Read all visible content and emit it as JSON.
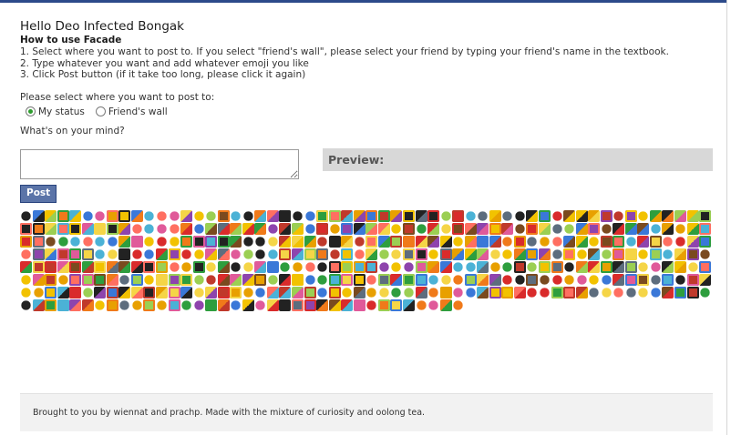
{
  "app": {
    "title": "Hello Deo Infected Bongak"
  },
  "howto": {
    "title": "How to use Facade",
    "steps": [
      "1. Select where you want to post to. If you select \"friend's wall\", please select your friend by typing your friend's name in the textbook.",
      "2. Type whatever you want and add whatever emoji you like",
      "3. Click Post button (if it take too long, please click it again)"
    ]
  },
  "post_target": {
    "prompt": "Please select where you want to post to:",
    "options": [
      {
        "label": "My status",
        "selected": true
      },
      {
        "label": "Friend's wall",
        "selected": false
      }
    ]
  },
  "composer": {
    "prompt": "What's on your mind?",
    "value": "",
    "placeholder": "",
    "preview_label": "Preview:",
    "post_label": "Post"
  },
  "emoji_palette": {
    "rows": 8,
    "description_note": "grid of pixel-art emoji icons"
  },
  "footer": {
    "text": "Brought to you by wiennat and prachp. Made with the mixture of curiosity and oolong tea."
  },
  "colors": {
    "post_button_bg": "#5b74a8",
    "post_button_border": "#29447e",
    "preview_bg": "#d8d8d8",
    "footer_bg": "#f2f2f2",
    "radio_selected": "#2d9c2d"
  }
}
